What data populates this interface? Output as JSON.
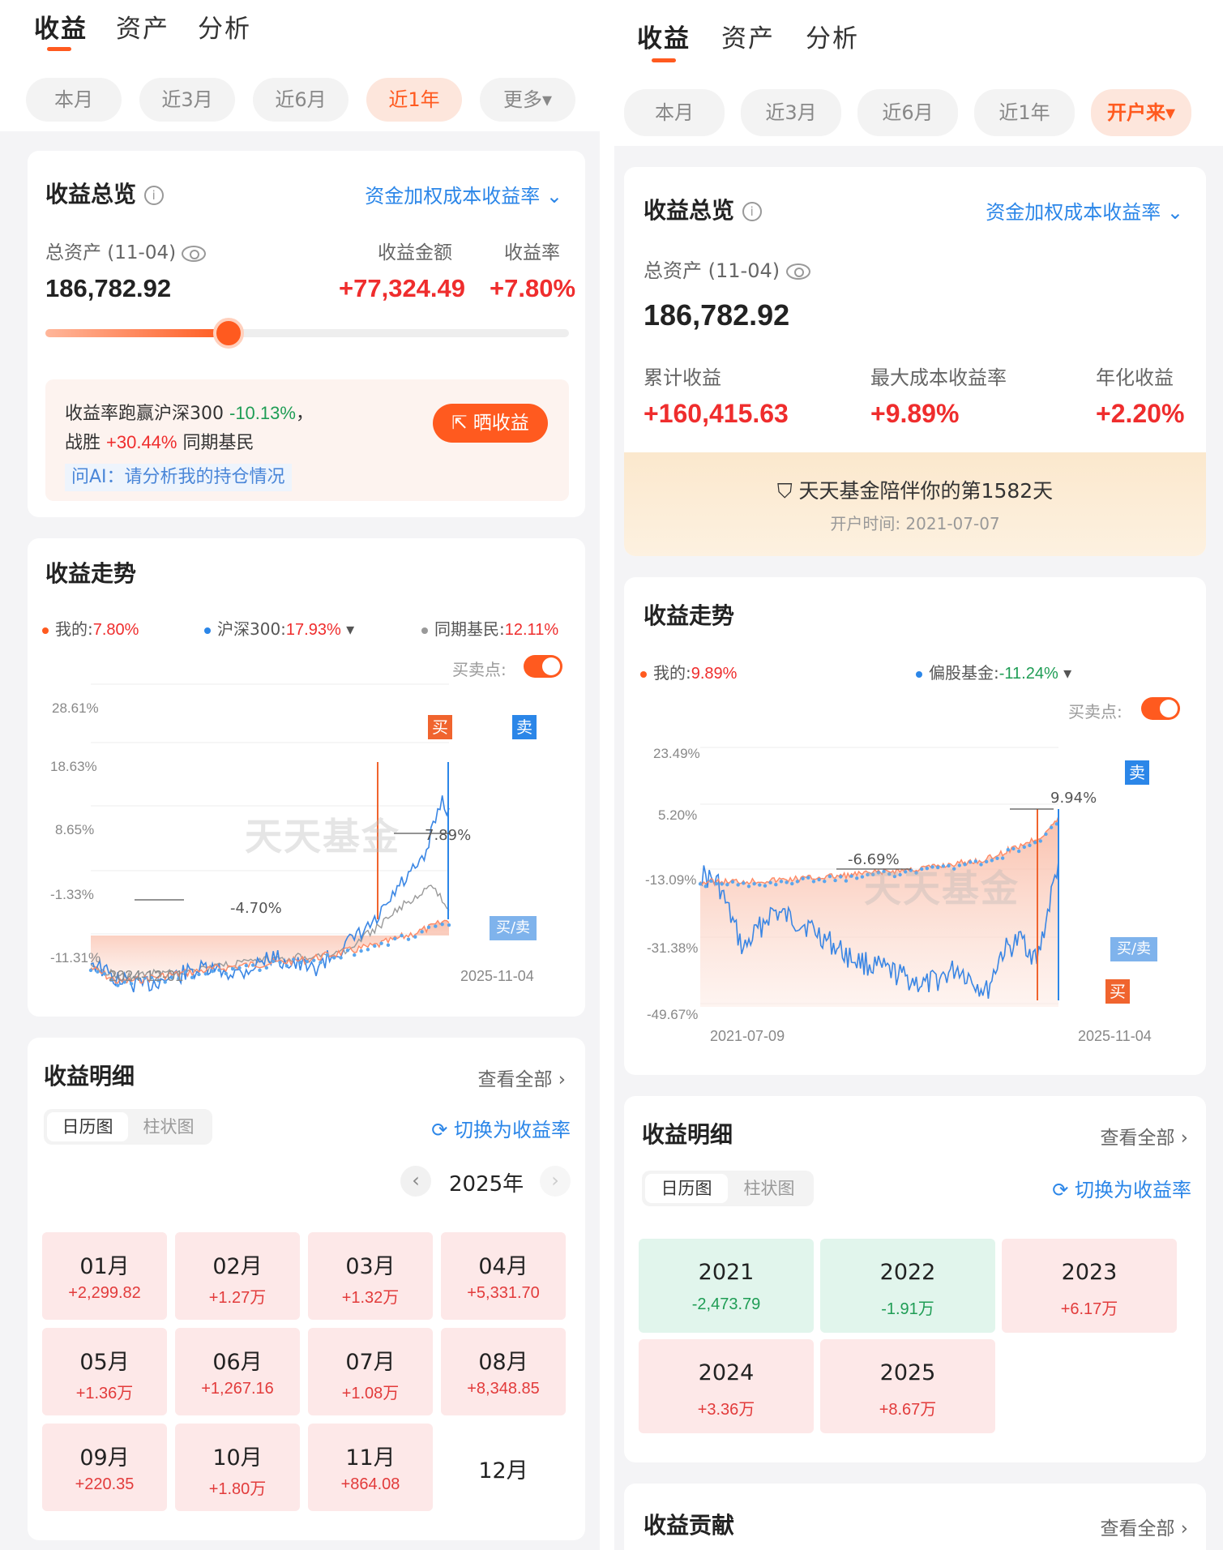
{
  "left": {
    "tabs": [
      "收益",
      "资产",
      "分析"
    ],
    "periods": [
      "本月",
      "近3月",
      "近6月",
      "近1年",
      "更多▾"
    ],
    "overview": {
      "title": "收益总览",
      "rate_method": "资金加权成本收益率",
      "total_label": "总资产 (11-04)",
      "total_value": "186,782.92",
      "amount_label": "收益金额",
      "amount_value": "+77,324.49",
      "rate_label": "收益率",
      "rate_value": "+7.80%",
      "progress_fraction": 0.35,
      "compare_prefix": "收益率跑赢沪深300",
      "compare_value": "-10.13%",
      "compare_mid": "，",
      "beat_prefix": "战胜",
      "beat_value": "+30.44%",
      "beat_suffix": "同期基民",
      "share_button": "晒收益",
      "ask_ai": "问AI：请分析我的持仓情况"
    },
    "trend": {
      "title": "收益走势",
      "legend_mine": "我的:",
      "legend_mine_value": "7.80%",
      "legend_index": "沪深300:",
      "legend_index_value": "17.93%",
      "legend_peers": "同期基民:",
      "legend_peers_value": "12.11%",
      "buysell_label": "买卖点:",
      "y_ticks": [
        "28.61%",
        "18.63%",
        "8.65%",
        "-1.33%",
        "-11.31%"
      ],
      "x_start": "2024-12-01",
      "x_end": "2025-11-04",
      "annotation_high": "7.89%",
      "annotation_low": "-4.70%",
      "tag_buy": "买",
      "tag_sell": "卖",
      "tag_buysell": "买/卖",
      "watermark": "天天基金"
    },
    "detail": {
      "title": "收益明细",
      "view_all": "查看全部",
      "seg_calendar": "日历图",
      "seg_bar": "柱状图",
      "switch": "切换为收益率",
      "year": "2025年",
      "months": [
        {
          "m": "01月",
          "v": "+2,299.82"
        },
        {
          "m": "02月",
          "v": "+1.27万"
        },
        {
          "m": "03月",
          "v": "+1.32万"
        },
        {
          "m": "04月",
          "v": "+5,331.70"
        },
        {
          "m": "05月",
          "v": "+1.36万"
        },
        {
          "m": "06月",
          "v": "+1,267.16"
        },
        {
          "m": "07月",
          "v": "+1.08万"
        },
        {
          "m": "08月",
          "v": "+8,348.85"
        },
        {
          "m": "09月",
          "v": "+220.35"
        },
        {
          "m": "10月",
          "v": "+1.80万"
        },
        {
          "m": "11月",
          "v": "+864.08"
        },
        {
          "m": "12月",
          "v": ""
        }
      ]
    }
  },
  "right": {
    "tabs": [
      "收益",
      "资产",
      "分析"
    ],
    "periods": [
      "本月",
      "近3月",
      "近6月",
      "近1年",
      "开户来▾"
    ],
    "overview": {
      "title": "收益总览",
      "rate_method": "资金加权成本收益率",
      "total_label": "总资产 (11-04)",
      "total_value": "186,782.92",
      "cum_label": "累计收益",
      "cum_value": "+160,415.63",
      "max_label": "最大成本收益率",
      "max_value": "+9.89%",
      "ann_label": "年化收益",
      "ann_value": "+2.20%",
      "companion": "天天基金陪伴你的第1582天",
      "open_date": "开户时间: 2021-07-07"
    },
    "trend": {
      "title": "收益走势",
      "legend_mine": "我的:",
      "legend_mine_value": "9.89%",
      "legend_fund": "偏股基金:",
      "legend_fund_value": "-11.24%",
      "buysell_label": "买卖点:",
      "y_ticks": [
        "23.49%",
        "5.20%",
        "-13.09%",
        "-31.38%",
        "-49.67%"
      ],
      "x_start": "2021-07-09",
      "x_end": "2025-11-04",
      "annotation_high": "9.94%",
      "annotation_low": "-6.69%",
      "tag_buy": "买",
      "tag_sell": "卖",
      "tag_buysell": "买/卖",
      "watermark": "天天基金"
    },
    "detail": {
      "title": "收益明细",
      "view_all": "查看全部",
      "seg_calendar": "日历图",
      "seg_bar": "柱状图",
      "switch": "切换为收益率",
      "years": [
        {
          "y": "2021",
          "v": "-2,473.79",
          "tone": "mint"
        },
        {
          "y": "2022",
          "v": "-1.91万",
          "tone": "mint"
        },
        {
          "y": "2023",
          "v": "+6.17万",
          "tone": "pink"
        },
        {
          "y": "2024",
          "v": "+3.36万",
          "tone": "pink"
        },
        {
          "y": "2025",
          "v": "+8.67万",
          "tone": "pink"
        }
      ]
    },
    "contribution": {
      "title": "收益贡献",
      "view_all": "查看全部"
    }
  },
  "colors": {
    "accent": "#ff5a1f",
    "gain": "#ef2d2d",
    "loss": "#1f9d55",
    "index_line": "#2b86e8",
    "peer_line": "#999999"
  }
}
